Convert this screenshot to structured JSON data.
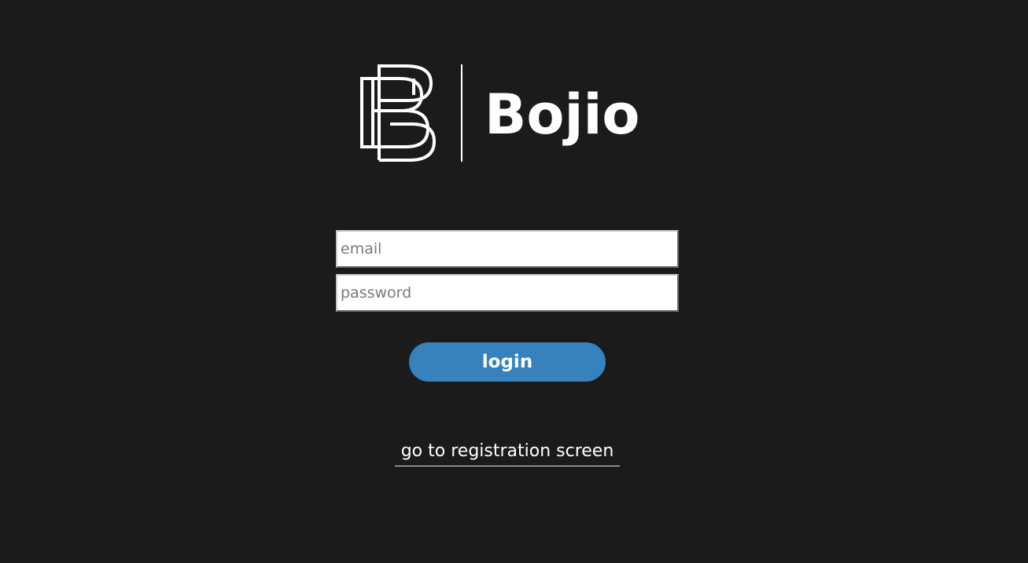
{
  "brand": {
    "name": "Bojio",
    "logo_icon": "bb-monogram-logo",
    "text_color": "#ffffff"
  },
  "login_form": {
    "email_placeholder": "email",
    "email_value": "",
    "password_placeholder": "password",
    "password_value": "",
    "login_label": "login",
    "login_color": "#3781bd"
  },
  "registration_link": {
    "label": "go to registration screen"
  },
  "theme": {
    "background": "#1b1b1b"
  }
}
